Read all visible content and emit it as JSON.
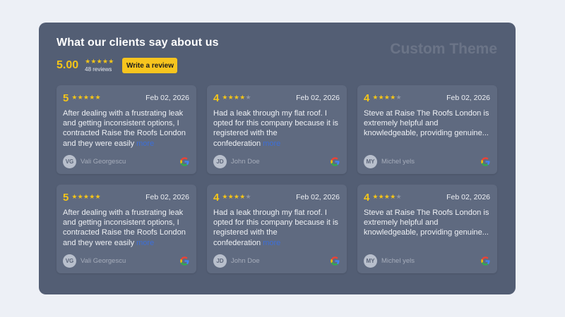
{
  "header": {
    "title": "What our clients say about us",
    "watermark": "Custom Theme"
  },
  "summary": {
    "rating": "5.00",
    "stars": "★★★★★",
    "count": "48 reviews",
    "write_button": "Write a review"
  },
  "colors": {
    "accent": "#f5c518",
    "widget_bg": "#535e74",
    "card_bg": "#5f6a80",
    "link": "#3d6fd8"
  },
  "reviews": [
    {
      "rating": "5",
      "stars_filled": 5,
      "date": "Feb 02, 2026",
      "text": "After dealing with a frustrating leak and getting inconsistent options, I contracted Raise the Roofs London and they were easily",
      "more": "more",
      "initials": "VG",
      "author": "Vali Georgescu",
      "source_icon": "google-icon"
    },
    {
      "rating": "4",
      "stars_filled": 4,
      "date": "Feb 02, 2026",
      "text": "Had a leak through my flat roof. I opted for this company because it is registered with the confederation",
      "more": "more",
      "initials": "JD",
      "author": "John Doe",
      "source_icon": "google-icon"
    },
    {
      "rating": "4",
      "stars_filled": 4,
      "date": "Feb 02, 2026",
      "text": "Steve at Raise The Roofs London is extremely helpful and knowledgeable, providing genuine...",
      "more": "",
      "initials": "MY",
      "author": "Michel yels",
      "source_icon": "google-icon"
    },
    {
      "rating": "5",
      "stars_filled": 5,
      "date": "Feb 02, 2026",
      "text": "After dealing with a frustrating leak and getting inconsistent options, I contracted Raise the Roofs London and they were easily",
      "more": "more",
      "initials": "VG",
      "author": "Vali Georgescu",
      "source_icon": "google-icon"
    },
    {
      "rating": "4",
      "stars_filled": 4,
      "date": "Feb 02, 2026",
      "text": "Had a leak through my flat roof. I opted for this company because it is registered with the confederation",
      "more": "more",
      "initials": "JD",
      "author": "John Doe",
      "source_icon": "google-icon"
    },
    {
      "rating": "4",
      "stars_filled": 4,
      "date": "Feb 02, 2026",
      "text": "Steve at Raise The Roofs London is extremely helpful and knowledgeable, providing genuine...",
      "more": "",
      "initials": "MY",
      "author": "Michel yels",
      "source_icon": "google-icon"
    }
  ]
}
